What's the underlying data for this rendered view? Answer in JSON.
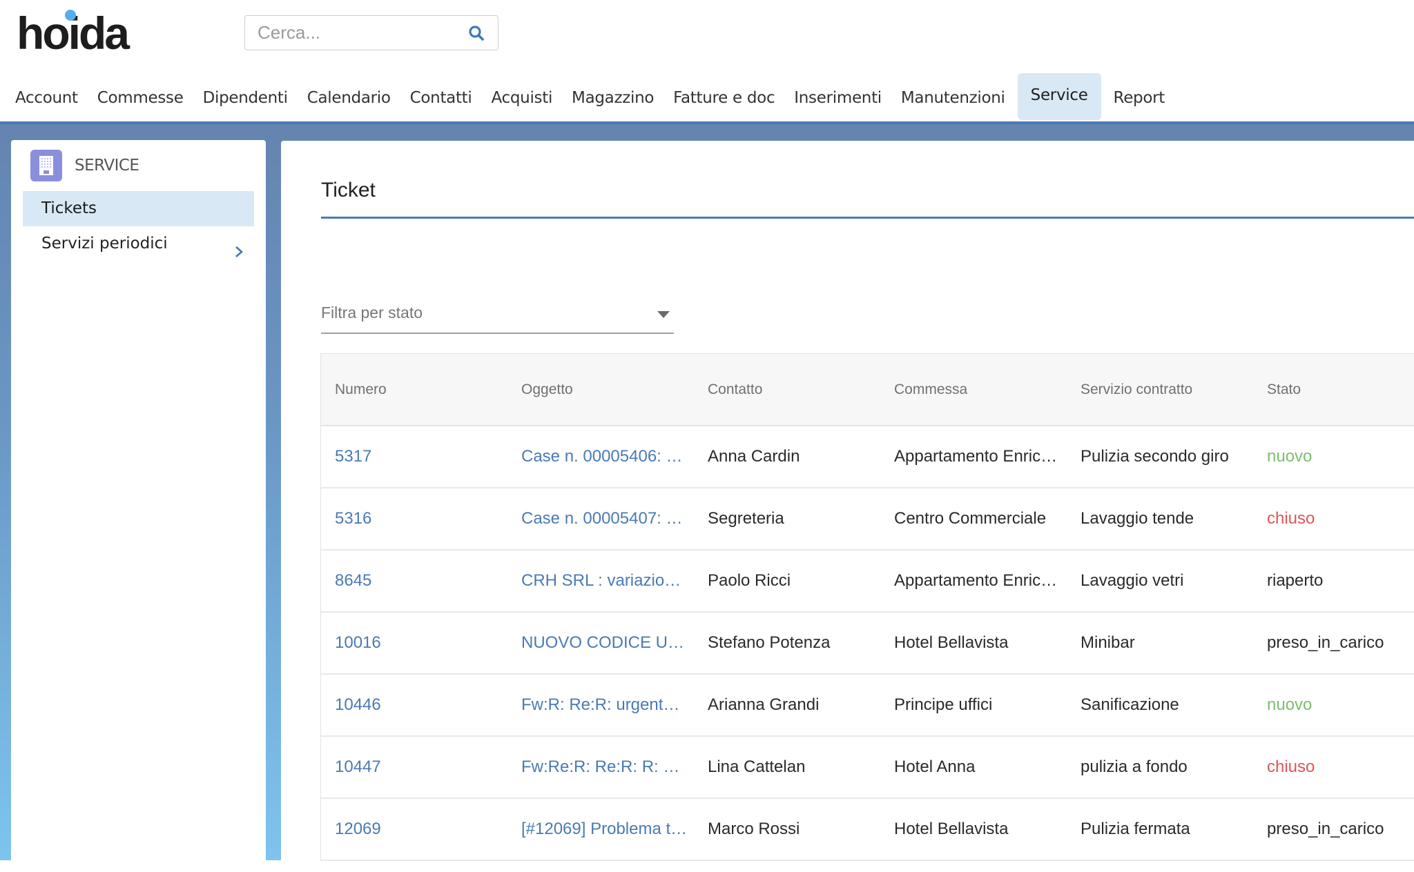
{
  "brand": {
    "logo_text": "hoida",
    "accent_color": "#56aef0"
  },
  "search": {
    "placeholder": "Cerca...",
    "value": "",
    "icon": "search-icon"
  },
  "nav": {
    "items": [
      {
        "label": "Account",
        "active": false
      },
      {
        "label": "Commesse",
        "active": false
      },
      {
        "label": "Dipendenti",
        "active": false
      },
      {
        "label": "Calendario",
        "active": false
      },
      {
        "label": "Contatti",
        "active": false
      },
      {
        "label": "Acquisti",
        "active": false
      },
      {
        "label": "Magazzino",
        "active": false
      },
      {
        "label": "Fatture e doc",
        "active": false
      },
      {
        "label": "Inserimenti",
        "active": false
      },
      {
        "label": "Manutenzioni",
        "active": false
      },
      {
        "label": "Service",
        "active": true
      },
      {
        "label": "Report",
        "active": false
      }
    ]
  },
  "sidebar": {
    "section_icon": "building-icon",
    "section_title": "SERVICE",
    "items": [
      {
        "label": "Tickets",
        "active": true,
        "has_submenu": false
      },
      {
        "label": "Servizi periodici",
        "active": false,
        "has_submenu": true
      }
    ]
  },
  "main": {
    "title": "Ticket",
    "filter": {
      "placeholder": "Filtra per stato",
      "value": ""
    },
    "table": {
      "columns": [
        "Numero",
        "Oggetto",
        "Contatto",
        "Commessa",
        "Servizio contratto",
        "Stato"
      ],
      "rows": [
        {
          "numero": "5317",
          "oggetto": "Case n. 00005406: …",
          "contatto": "Anna Cardin",
          "commessa": "Appartamento Enric…",
          "servizio": "Pulizia secondo giro",
          "stato": "nuovo"
        },
        {
          "numero": "5316",
          "oggetto": "Case n. 00005407: …",
          "contatto": "Segreteria",
          "commessa": "Centro Commerciale",
          "servizio": "Lavaggio tende",
          "stato": "chiuso"
        },
        {
          "numero": "8645",
          "oggetto": "CRH SRL : variazion…",
          "contatto": "Paolo Ricci",
          "commessa": "Appartamento Enric…",
          "servizio": "Lavaggio vetri",
          "stato": "riaperto"
        },
        {
          "numero": "10016",
          "oggetto": "NUOVO CODICE UNI…",
          "contatto": "Stefano Potenza",
          "commessa": "Hotel Bellavista",
          "servizio": "Minibar",
          "stato": "preso_in_carico"
        },
        {
          "numero": "10446",
          "oggetto": "Fw:R: Re:R: urgente …",
          "contatto": "Arianna Grandi",
          "commessa": "Principe uffici",
          "servizio": "Sanificazione",
          "stato": "nuovo"
        },
        {
          "numero": "10447",
          "oggetto": "Fw:Re:R: Re:R: R: FA…",
          "contatto": "Lina Cattelan",
          "commessa": "Hotel Anna",
          "servizio": "pulizia a fondo",
          "stato": "chiuso"
        },
        {
          "numero": "12069",
          "oggetto": "[#12069] Problema t…",
          "contatto": "Marco Rossi",
          "commessa": "Hotel Bellavista",
          "servizio": "Pulizia fermata",
          "stato": "preso_in_carico"
        }
      ]
    },
    "status_colors": {
      "nuovo": "#7bbf6a",
      "chiuso": "#e05555",
      "link": "#4a7ab4"
    }
  }
}
